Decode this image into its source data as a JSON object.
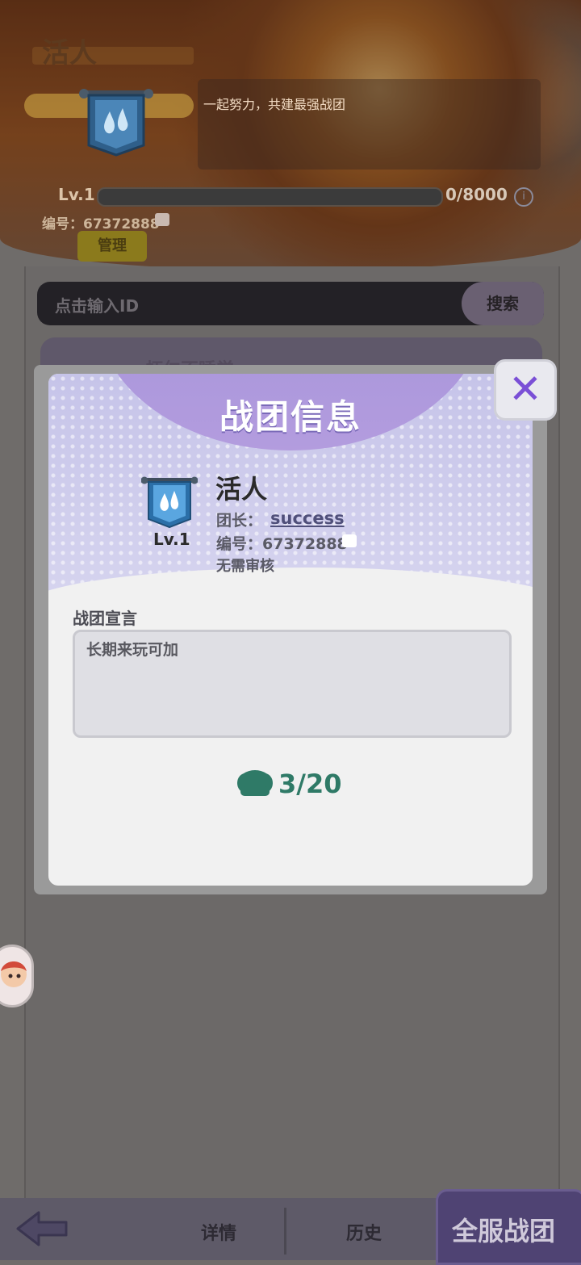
{
  "header": {
    "guild_name": "活人",
    "motto": "一起努力，共建最强战团",
    "level_label": "Lv.1",
    "exp_text": "0/8000",
    "info_icon": "info-icon",
    "id_label": "编号：67372888",
    "manage_label": "管理"
  },
  "search": {
    "placeholder": "点击输入ID",
    "button_label": "搜索"
  },
  "list": {
    "first_item_title": "虾仁不睡觉"
  },
  "modal": {
    "title": "战团信息",
    "guild_name": "活人",
    "level_badge": "Lv.1",
    "leader_label": "团长：",
    "leader_name": "success",
    "id_label": "编号：67372888",
    "review_text": "无需审核",
    "declaration_label": "战团宣言",
    "declaration_text": "长期来玩可加",
    "members_text": "3/20",
    "close_icon": "close-icon",
    "members_icon": "members-icon"
  },
  "nav": {
    "back_icon": "back-arrow-icon",
    "detail_label": "详情",
    "history_label": "历史",
    "all_server_label": "全服战团"
  },
  "colors": {
    "accent_purple": "#7a4fd6",
    "members_green": "#2f7a67",
    "banner_blue": "#4a9cd6"
  }
}
